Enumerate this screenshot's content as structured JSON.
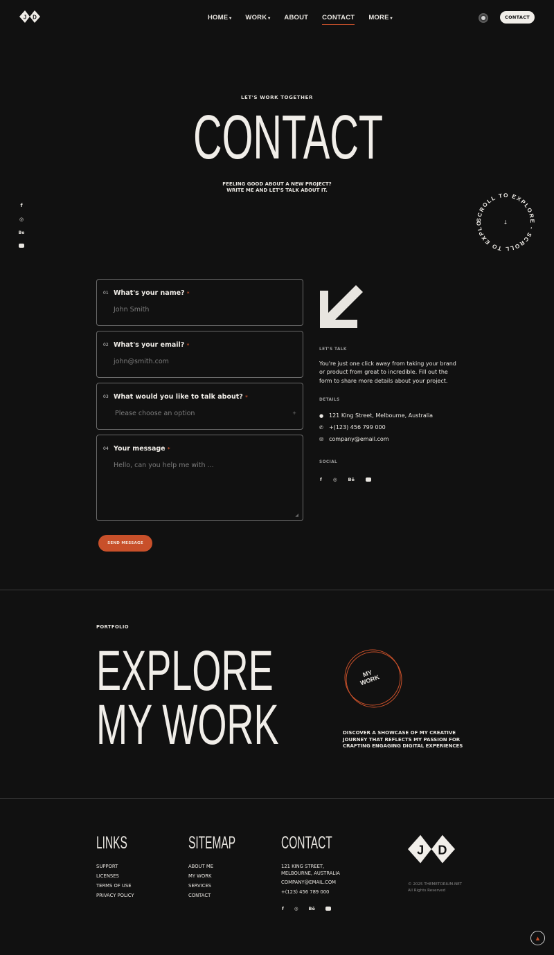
{
  "header": {
    "logo_text": "JD",
    "nav": [
      {
        "label": "HOME",
        "has_dropdown": true,
        "active": false
      },
      {
        "label": "WORK",
        "has_dropdown": true,
        "active": false
      },
      {
        "label": "ABOUT",
        "has_dropdown": false,
        "active": false
      },
      {
        "label": "CONTACT",
        "has_dropdown": false,
        "active": true
      },
      {
        "label": "MORE",
        "has_dropdown": true,
        "active": false
      }
    ],
    "cta_label": "CONTACT"
  },
  "hero": {
    "eyebrow": "LET'S WORK TOGETHER",
    "title": "CONTACT",
    "subtitle_line1": "FEELING GOOD ABOUT A NEW PROJECT?",
    "subtitle_line2": "WRITE ME AND LET'S TALK ABOUT IT.",
    "scroll_badge": "SCROLL TO EXPLORE - SCROLL TO EXPLORE -"
  },
  "side_social": [
    "f",
    "@",
    "Be",
    "yt"
  ],
  "form": {
    "fields": [
      {
        "num": "01",
        "label": "What's your name?",
        "required": "*",
        "placeholder": "John Smith"
      },
      {
        "num": "02",
        "label": "What's your email?",
        "required": "*",
        "placeholder": "john@smith.com"
      },
      {
        "num": "03",
        "label": "What would you like to talk about?",
        "required": "*",
        "placeholder": "Please choose an option"
      },
      {
        "num": "04",
        "label": "Your message",
        "required": "*",
        "placeholder": "Hello, can you help me with ..."
      }
    ],
    "submit_label": "SEND MESSAGE"
  },
  "sidebar": {
    "lets_talk_heading": "LET'S TALK",
    "lets_talk_text": "You're just one click away from taking your brand or product from great to incredible. Fill out the form to share more details about your project.",
    "details_heading": "DETAILS",
    "address": "121 King Street, Melbourne, Australia",
    "phone": "+(123) 456 799 000",
    "email": "company@email.com",
    "social_heading": "SOCIAL",
    "social": [
      "f",
      "@",
      "Bē",
      "yt"
    ]
  },
  "portfolio": {
    "eyebrow": "PORTFOLIO",
    "title_line1": "EXPLORE",
    "title_line2": "MY WORK",
    "badge_line1": "MY",
    "badge_line2": "WORK",
    "desc_line1": "DISCOVER A SHOWCASE OF MY CREATIVE",
    "desc_line2": "JOURNEY THAT REFLECTS MY PASSION FOR",
    "desc_line3": "CRAFTING ENGAGING DIGITAL EXPERIENCES"
  },
  "footer": {
    "links_heading": "LINKS",
    "links": [
      "SUPPORT",
      "LICENSES",
      "TERMS OF USE",
      "PRIVACY POLICY"
    ],
    "sitemap_heading": "SITEMAP",
    "sitemap": [
      "ABOUT ME",
      "MY WORK",
      "SERVICES",
      "CONTACT"
    ],
    "contact_heading": "CONTACT",
    "address_line1": "121 KING STREET,",
    "address_line2": "MELBOURNE, AUSTRALIA",
    "email": "COMPANY@EMAIL.COM",
    "phone": "+(123) 456 789 000",
    "social": [
      "f",
      "@",
      "Bē",
      "yt"
    ],
    "logo_text": "JD",
    "copyright_line1": "© 2025 THEMETORIUM.NET",
    "copyright_line2": "All Rights Reserved"
  },
  "colors": {
    "background": "#111111",
    "accent": "#c8502a",
    "text": "#e9e6e1"
  },
  "icons": {
    "theme_toggle": "toggle-icon",
    "big_arrow": "arrow-down-left-icon",
    "scroll_top": "arrow-up-icon"
  }
}
